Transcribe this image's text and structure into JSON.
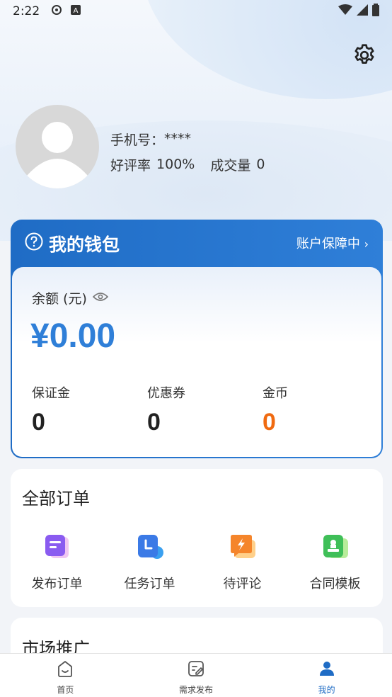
{
  "status_bar": {
    "time": "2:22",
    "icons": [
      "sync-icon",
      "a-badge-icon",
      "wifi-icon",
      "signal-icon",
      "battery-icon"
    ]
  },
  "profile": {
    "phone_label": "手机号：",
    "phone_value": "****",
    "rating_label": "好评率",
    "rating_value": "100%",
    "deals_label": "成交量",
    "deals_value": "0"
  },
  "wallet": {
    "title": "我的钱包",
    "protect_label": "账户保障中",
    "balance_label": "余额 (元)",
    "balance_value": "¥0.00",
    "stats": [
      {
        "label": "保证金",
        "value": "0"
      },
      {
        "label": "优惠券",
        "value": "0"
      },
      {
        "label": "金币",
        "value": "0"
      }
    ],
    "colors": {
      "primary": "#2f7fd8",
      "coin": "#f06a10"
    }
  },
  "orders": {
    "title": "全部订单",
    "items": [
      {
        "label": "发布订单",
        "icon": "publish-order-icon"
      },
      {
        "label": "任务订单",
        "icon": "task-order-icon"
      },
      {
        "label": "待评论",
        "icon": "pending-review-icon"
      },
      {
        "label": "合同模板",
        "icon": "contract-template-icon"
      }
    ]
  },
  "market": {
    "title": "市场推广"
  },
  "tabbar": {
    "tabs": [
      {
        "label": "首页",
        "icon": "home-icon"
      },
      {
        "label": "需求发布",
        "icon": "edit-icon"
      },
      {
        "label": "我的",
        "icon": "user-icon"
      }
    ],
    "active_color": "#1f6cc5"
  }
}
